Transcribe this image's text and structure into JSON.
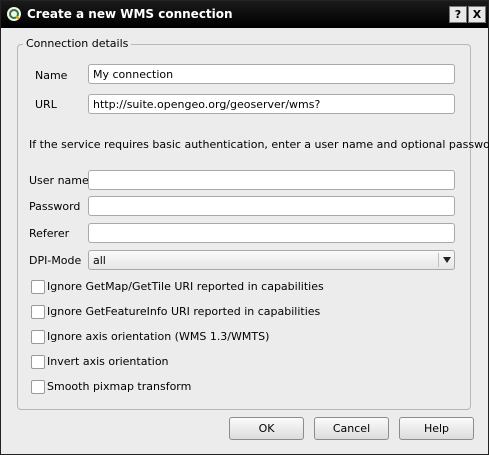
{
  "window": {
    "title": "Create a new WMS connection",
    "help_button": "?",
    "close_button": "X"
  },
  "group": {
    "label": "Connection details"
  },
  "fields": {
    "name_label": "Name",
    "name_value": "My connection",
    "url_label": "URL",
    "url_value": "http://suite.opengeo.org/geoserver/wms?",
    "auth_info": "If the service requires basic authentication, enter a user name and optional password",
    "username_label": "User name",
    "username_value": "",
    "password_label": "Password",
    "password_value": "",
    "referer_label": "Referer",
    "referer_value": "",
    "dpi_label": "DPI-Mode",
    "dpi_value": "all"
  },
  "checkboxes": [
    {
      "label": "Ignore GetMap/GetTile URI reported in capabilities",
      "checked": false
    },
    {
      "label": "Ignore GetFeatureInfo URI reported in capabilities",
      "checked": false
    },
    {
      "label": "Ignore axis orientation (WMS 1.3/WMTS)",
      "checked": false
    },
    {
      "label": "Invert axis orientation",
      "checked": false
    },
    {
      "label": "Smooth pixmap transform",
      "checked": false
    }
  ],
  "buttons": {
    "ok": "OK",
    "cancel": "Cancel",
    "help": "Help"
  },
  "icons": {
    "app": "qgis-icon",
    "combo": "chevron-down-icon"
  }
}
